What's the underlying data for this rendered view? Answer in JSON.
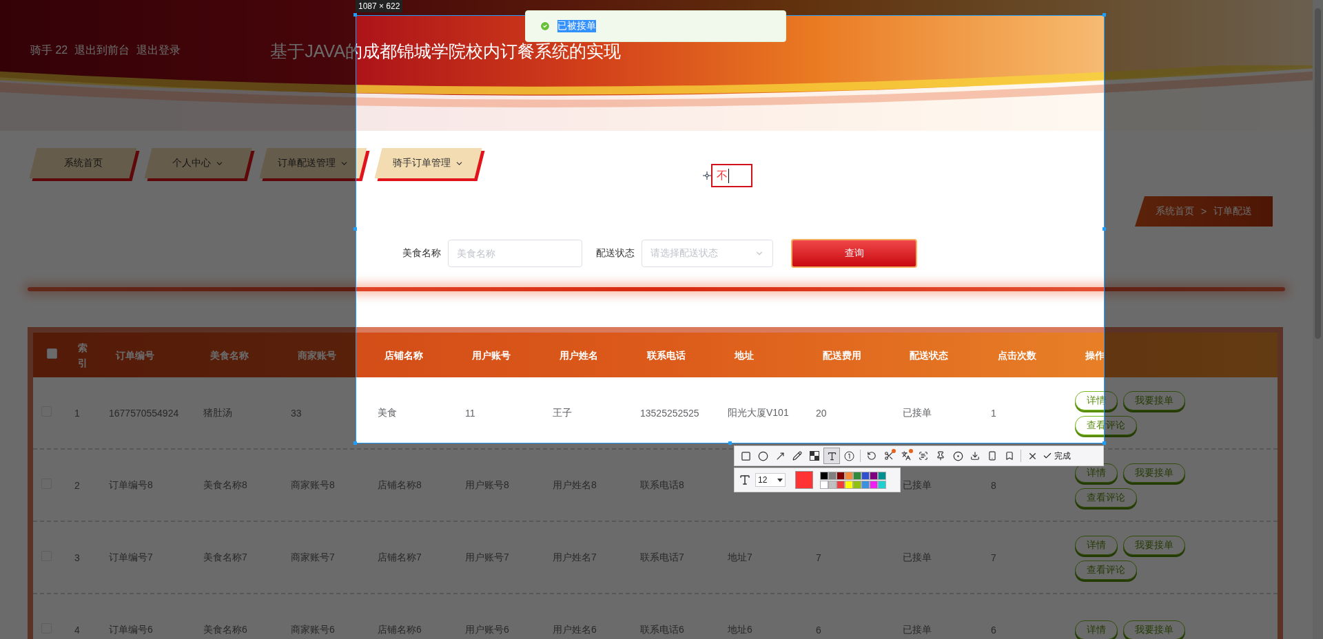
{
  "header": {
    "user_label": "骑手 22",
    "links": [
      "退出到前台",
      "退出登录"
    ],
    "title": "基于JAVA的成都锦城学院校内订餐系统的实现"
  },
  "nav": [
    {
      "label": "系统首页",
      "has_menu": false
    },
    {
      "label": "个人中心",
      "has_menu": true
    },
    {
      "label": "订单配送管理",
      "has_menu": true
    },
    {
      "label": "骑手订单管理",
      "has_menu": true
    }
  ],
  "breadcrumb": {
    "items": [
      "系统首页",
      "订单配送"
    ],
    "separator": ">"
  },
  "search": {
    "fields": [
      {
        "kind": "input",
        "label": "美食名称",
        "placeholder": "美食名称"
      },
      {
        "kind": "select",
        "label": "配送状态",
        "placeholder": "请选择配送状态"
      }
    ],
    "button": "查询"
  },
  "table": {
    "all_checked": false,
    "columns": [
      "索引",
      "订单编号",
      "美食名称",
      "商家账号",
      "店铺名称",
      "用户账号",
      "用户姓名",
      "联系电话",
      "地址",
      "配送费用",
      "配送状态",
      "点击次数",
      "操作"
    ],
    "rows": [
      {
        "checked": false,
        "cells": [
          "1",
          "1677570554924",
          "猪肚汤",
          "33",
          "美食",
          "11",
          "王子",
          "13525252525",
          "阳光大厦V101",
          "20",
          "已接单",
          "1"
        ],
        "actions": [
          "详情",
          "我要接单",
          "查看评论"
        ]
      },
      {
        "checked": false,
        "cells": [
          "2",
          "订单编号8",
          "美食名称8",
          "商家账号8",
          "店铺名称8",
          "用户账号8",
          "用户姓名8",
          "联系电话8",
          null,
          null,
          "已接单",
          "8"
        ],
        "actions": [
          "详情",
          "我要接单",
          "查看评论"
        ]
      },
      {
        "checked": false,
        "cells": [
          "3",
          "订单编号7",
          "美食名称7",
          "商家账号7",
          "店铺名称7",
          "用户账号7",
          "用户姓名7",
          "联系电话7",
          "地址7",
          "7",
          "已接单",
          "7"
        ],
        "actions": [
          "详情",
          "我要接单",
          "查看评论"
        ]
      },
      {
        "checked": false,
        "cells": [
          "4",
          "订单编号6",
          "美食名称6",
          "商家账号6",
          "店铺名称6",
          "用户账号6",
          "用户姓名6",
          "联系电话6",
          "地址6",
          "6",
          "已接单",
          "6"
        ],
        "actions": [
          "详情",
          "我要接单"
        ]
      }
    ]
  },
  "toast": {
    "kind": "success",
    "message": "已被接单",
    "text_selected": true
  },
  "screenshot_tool": {
    "size_label": "1087 × 622",
    "annotation_text": "不",
    "tool_groups": [
      [
        {
          "kind": "rectangle",
          "selected": false,
          "badge": false
        },
        {
          "kind": "ellipse",
          "selected": false,
          "badge": false
        },
        {
          "kind": "arrow",
          "selected": false,
          "badge": false
        },
        {
          "kind": "pencil",
          "selected": false,
          "badge": false
        },
        {
          "kind": "mosaic",
          "selected": false,
          "badge": false
        },
        {
          "kind": "text",
          "selected": true,
          "badge": false
        },
        {
          "kind": "number",
          "selected": false,
          "badge": false
        }
      ],
      [
        {
          "kind": "undo",
          "selected": false,
          "badge": false
        },
        {
          "kind": "cut",
          "selected": false,
          "badge": true
        },
        {
          "kind": "translate",
          "selected": false,
          "badge": true
        },
        {
          "kind": "ocr",
          "selected": false,
          "badge": false
        },
        {
          "kind": "pin",
          "selected": false,
          "badge": false
        },
        {
          "kind": "record",
          "selected": false,
          "badge": false
        },
        {
          "kind": "download",
          "selected": false,
          "badge": false
        },
        {
          "kind": "phone",
          "selected": false,
          "badge": false
        },
        {
          "kind": "bookmark",
          "selected": false,
          "badge": false
        }
      ],
      [
        {
          "kind": "close",
          "selected": false,
          "badge": false
        }
      ]
    ],
    "done_label": "完成",
    "font_size": "12",
    "current_swatch": {
      "color": "#ff3333"
    },
    "palette": [
      {
        "color": "#000000"
      },
      {
        "color": "#808080"
      },
      {
        "color": "#800000"
      },
      {
        "color": "#f08c3c"
      },
      {
        "color": "#2e8b3a"
      },
      {
        "color": "#3050d0"
      },
      {
        "color": "#800080"
      },
      {
        "color": "#009090"
      },
      {
        "color": "#ffffff"
      },
      {
        "color": "#c0c0c0"
      },
      {
        "color": "#f03c3c"
      },
      {
        "color": "#ffff00"
      },
      {
        "color": "#90c010"
      },
      {
        "color": "#3c90e0"
      },
      {
        "color": "#f020f0"
      },
      {
        "color": "#20d0d0"
      }
    ]
  }
}
